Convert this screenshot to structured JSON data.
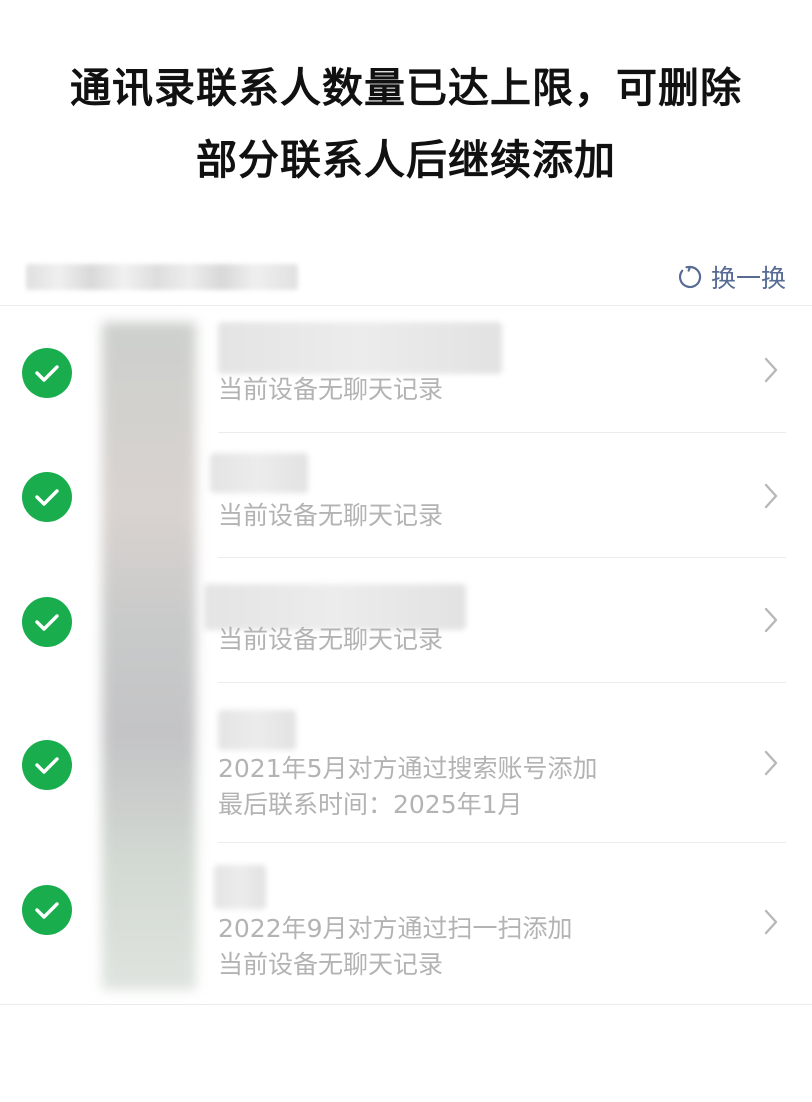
{
  "header": {
    "title_line1": "通讯录联系人数量已达上限，可删除",
    "title_line2": "部分联系人后继续添加"
  },
  "toolbar": {
    "refresh_label": "换一换",
    "refresh_icon": "refresh-icon"
  },
  "contacts": [
    {
      "selected": true,
      "line1": "当前设备无聊天记录",
      "line2": ""
    },
    {
      "selected": true,
      "line1": "当前设备无聊天记录",
      "line2": ""
    },
    {
      "selected": true,
      "line1": "当前设备无聊天记录",
      "line2": ""
    },
    {
      "selected": true,
      "line1": "2021年5月对方通过搜索账号添加",
      "line2": "最后联系时间：2025年1月"
    },
    {
      "selected": true,
      "line1": "2022年9月对方通过扫一扫添加",
      "line2": "当前设备无聊天记录"
    }
  ],
  "colors": {
    "check_green": "#1aad4e",
    "link_blue": "#576b95",
    "secondary_text": "#b3b3b3"
  }
}
